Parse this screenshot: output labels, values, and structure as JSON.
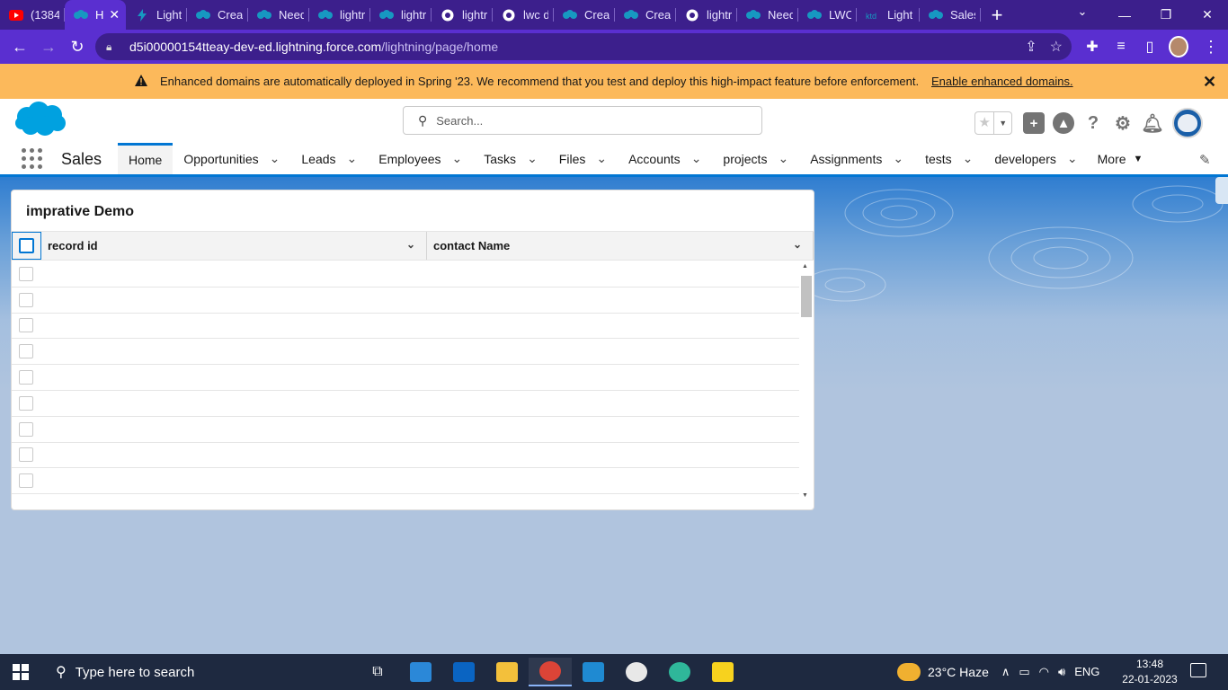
{
  "browser": {
    "tabs": [
      {
        "title": "(1384",
        "icon": "youtube-icon",
        "color": "#ff0000"
      },
      {
        "title": "H",
        "icon": "salesforce-cloud-icon",
        "active": true,
        "color": "#1798c1"
      },
      {
        "title": "Light",
        "icon": "lightning-bolt-icon",
        "color": "#1798c1"
      },
      {
        "title": "Creat",
        "icon": "salesforce-cloud-icon",
        "color": "#1798c1"
      },
      {
        "title": "Need",
        "icon": "salesforce-cloud-icon",
        "color": "#1798c1"
      },
      {
        "title": "lightr",
        "icon": "salesforce-cloud-icon",
        "color": "#1798c1"
      },
      {
        "title": "lightr",
        "icon": "salesforce-cloud-icon",
        "color": "#1798c1"
      },
      {
        "title": "lightr",
        "icon": "github-icon",
        "color": "#ffffff"
      },
      {
        "title": "lwc d",
        "icon": "google-icon",
        "color": "#ffffff"
      },
      {
        "title": "Creat",
        "icon": "salesforce-cloud-icon",
        "color": "#1798c1"
      },
      {
        "title": "Creat",
        "icon": "salesforce-cloud-icon",
        "color": "#1798c1"
      },
      {
        "title": "lightr",
        "icon": "google-icon",
        "color": "#ffffff"
      },
      {
        "title": "Need",
        "icon": "salesforce-cloud-icon",
        "color": "#1798c1"
      },
      {
        "title": "LWC",
        "icon": "salesforce-cloud-icon",
        "color": "#1798c1"
      },
      {
        "title": "Light",
        "icon": "ktd-icon",
        "color": "#1798c1"
      },
      {
        "title": "Sales",
        "icon": "salesforce-cloud-icon",
        "color": "#1798c1"
      }
    ],
    "close_glyph": "✕",
    "new_tab_glyph": "+",
    "url_host": "d5i00000154tteay-dev-ed.lightning.force.com",
    "url_path": "/lightning/page/home",
    "accent": "#5a2fd0"
  },
  "banner": {
    "message": "Enhanced domains are automatically deployed in Spring '23. We recommend that you test and deploy this high-impact feature before enforcement.",
    "link": "Enable enhanced domains.",
    "color": "#fcb95b"
  },
  "header": {
    "search_placeholder": "Search..."
  },
  "nav": {
    "app_name": "Sales",
    "items": [
      {
        "label": "Home",
        "active": true
      },
      {
        "label": "Opportunities"
      },
      {
        "label": "Leads"
      },
      {
        "label": "Employees"
      },
      {
        "label": "Tasks"
      },
      {
        "label": "Files"
      },
      {
        "label": "Accounts"
      },
      {
        "label": "projects"
      },
      {
        "label": "Assignments"
      },
      {
        "label": "tests"
      },
      {
        "label": "developers"
      }
    ],
    "more_label": "More"
  },
  "card": {
    "title": "imprative Demo",
    "columns": [
      "record id",
      "contact Name"
    ],
    "empty_row_count": 9
  },
  "taskbar": {
    "search_placeholder": "Type here to search",
    "weather": "23°C  Haze",
    "language": "ENG",
    "time": "13:48",
    "date": "22-01-2023"
  }
}
